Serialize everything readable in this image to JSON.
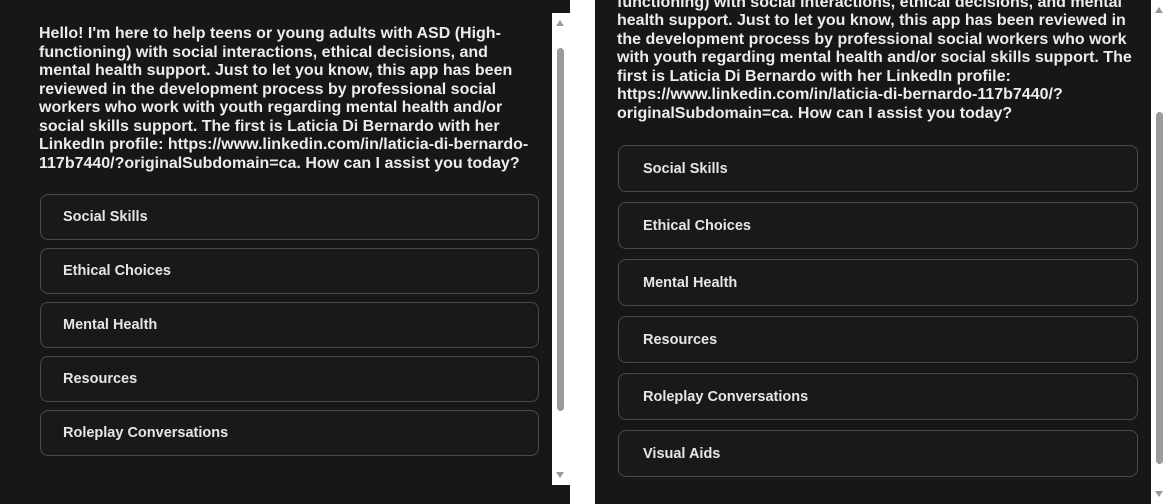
{
  "left": {
    "message": "Hello! I'm here to help teens or young adults with ASD (High-functioning) with social interactions, ethical decisions, and mental health support. Just to let you know, this app has been reviewed in the development process by professional social workers who work with youth regarding mental health and/or social skills support. The first is Laticia Di Bernardo with her LinkedIn profile: https://www.linkedin.com/in/laticia-di-bernardo-117b7440/?originalSubdomain=ca. How can I assist you today?",
    "options": [
      "Social Skills",
      "Ethical Choices",
      "Mental Health",
      "Resources",
      "Roleplay Conversations"
    ]
  },
  "right": {
    "message": "Hello! I'm here to help teens or young adults with ASD (High-functioning) with social interactions, ethical decisions, and mental health support. Just to let you know, this app has been reviewed in the development process by professional social workers who work with youth regarding mental health and/or social skills support. The first is Laticia Di Bernardo with her LinkedIn profile: https://www.linkedin.com/in/laticia-di-bernardo-117b7440/?originalSubdomain=ca. How can I assist you today?",
    "options": [
      "Social Skills",
      "Ethical Choices",
      "Mental Health",
      "Resources",
      "Roleplay Conversations",
      "Visual Aids"
    ]
  },
  "scrollbar_icons": {
    "up": "scroll-up-arrow-icon",
    "down": "scroll-down-arrow-icon"
  },
  "colors": {
    "background": "#171717",
    "option_border": "#4a4a4a",
    "text": "#ececec"
  }
}
